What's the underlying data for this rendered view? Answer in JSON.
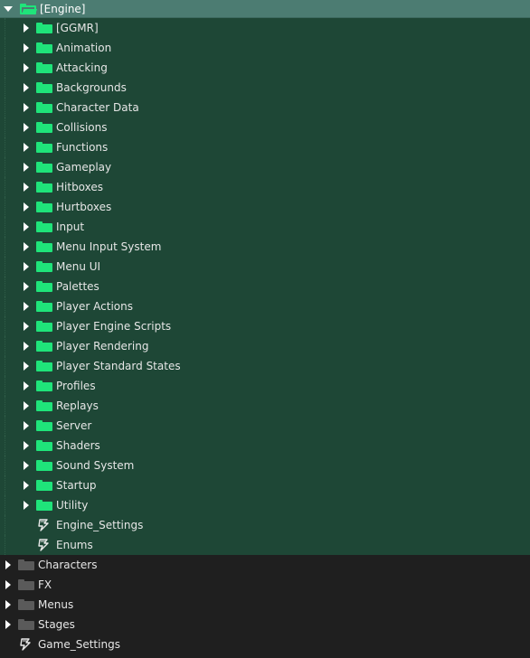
{
  "root": {
    "label": "[Engine]",
    "expanded": true,
    "icon": "open-folder-icon",
    "color": "#1fe47a",
    "children": [
      {
        "type": "folder",
        "label": "[GGMR]"
      },
      {
        "type": "folder",
        "label": "Animation"
      },
      {
        "type": "folder",
        "label": "Attacking"
      },
      {
        "type": "folder",
        "label": "Backgrounds"
      },
      {
        "type": "folder",
        "label": "Character Data"
      },
      {
        "type": "folder",
        "label": "Collisions"
      },
      {
        "type": "folder",
        "label": "Functions"
      },
      {
        "type": "folder",
        "label": "Gameplay"
      },
      {
        "type": "folder",
        "label": "Hitboxes"
      },
      {
        "type": "folder",
        "label": "Hurtboxes"
      },
      {
        "type": "folder",
        "label": "Input"
      },
      {
        "type": "folder",
        "label": "Menu Input System"
      },
      {
        "type": "folder",
        "label": "Menu UI"
      },
      {
        "type": "folder",
        "label": "Palettes"
      },
      {
        "type": "folder",
        "label": "Player Actions"
      },
      {
        "type": "folder",
        "label": "Player Engine Scripts"
      },
      {
        "type": "folder",
        "label": "Player Rendering"
      },
      {
        "type": "folder",
        "label": "Player Standard States"
      },
      {
        "type": "folder",
        "label": "Profiles"
      },
      {
        "type": "folder",
        "label": "Replays"
      },
      {
        "type": "folder",
        "label": "Server"
      },
      {
        "type": "folder",
        "label": "Shaders"
      },
      {
        "type": "folder",
        "label": "Sound System"
      },
      {
        "type": "folder",
        "label": "Startup"
      },
      {
        "type": "folder",
        "label": "Utility"
      },
      {
        "type": "script",
        "label": "Engine_Settings"
      },
      {
        "type": "script",
        "label": "Enums"
      }
    ]
  },
  "top_level": [
    {
      "type": "folder",
      "label": "Characters"
    },
    {
      "type": "folder",
      "label": "FX"
    },
    {
      "type": "folder",
      "label": "Menus"
    },
    {
      "type": "folder",
      "label": "Stages"
    },
    {
      "type": "script",
      "label": "Game_Settings"
    }
  ],
  "colors": {
    "accent_folder": "#1fe47a",
    "group_background": "#1e4736",
    "root_header": "#4c7c72",
    "plain_folder": "#5a5a5a",
    "panel_background": "#1f1f1f"
  }
}
